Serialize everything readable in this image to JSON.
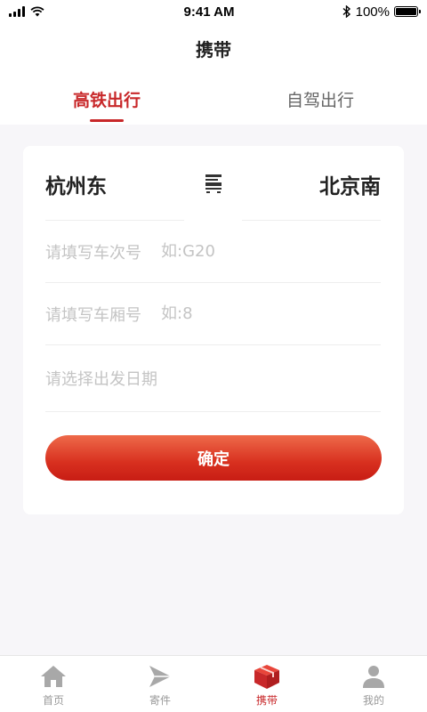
{
  "status_bar": {
    "time": "9:41 AM",
    "battery": "100%"
  },
  "nav": {
    "title": "携带"
  },
  "tabs": [
    {
      "label": "高铁出行",
      "active": true
    },
    {
      "label": "自驾出行",
      "active": false
    }
  ],
  "route": {
    "from": "杭州东",
    "to": "北京南",
    "icon": "train-icon"
  },
  "form": {
    "train_label": "请填写车次号",
    "train_placeholder": "如:G20",
    "car_label": "请填写车厢号",
    "car_placeholder": "如:8",
    "date_label": "请选择出发日期",
    "confirm_label": "确定"
  },
  "tabbar": [
    {
      "label": "首页",
      "icon": "home-icon",
      "active": false
    },
    {
      "label": "寄件",
      "icon": "send-icon",
      "active": false
    },
    {
      "label": "携带",
      "icon": "box-icon",
      "active": true
    },
    {
      "label": "我的",
      "icon": "user-icon",
      "active": false
    }
  ],
  "colors": {
    "accent": "#c8282a",
    "inactive": "#999999",
    "background": "#f7f6f9"
  }
}
